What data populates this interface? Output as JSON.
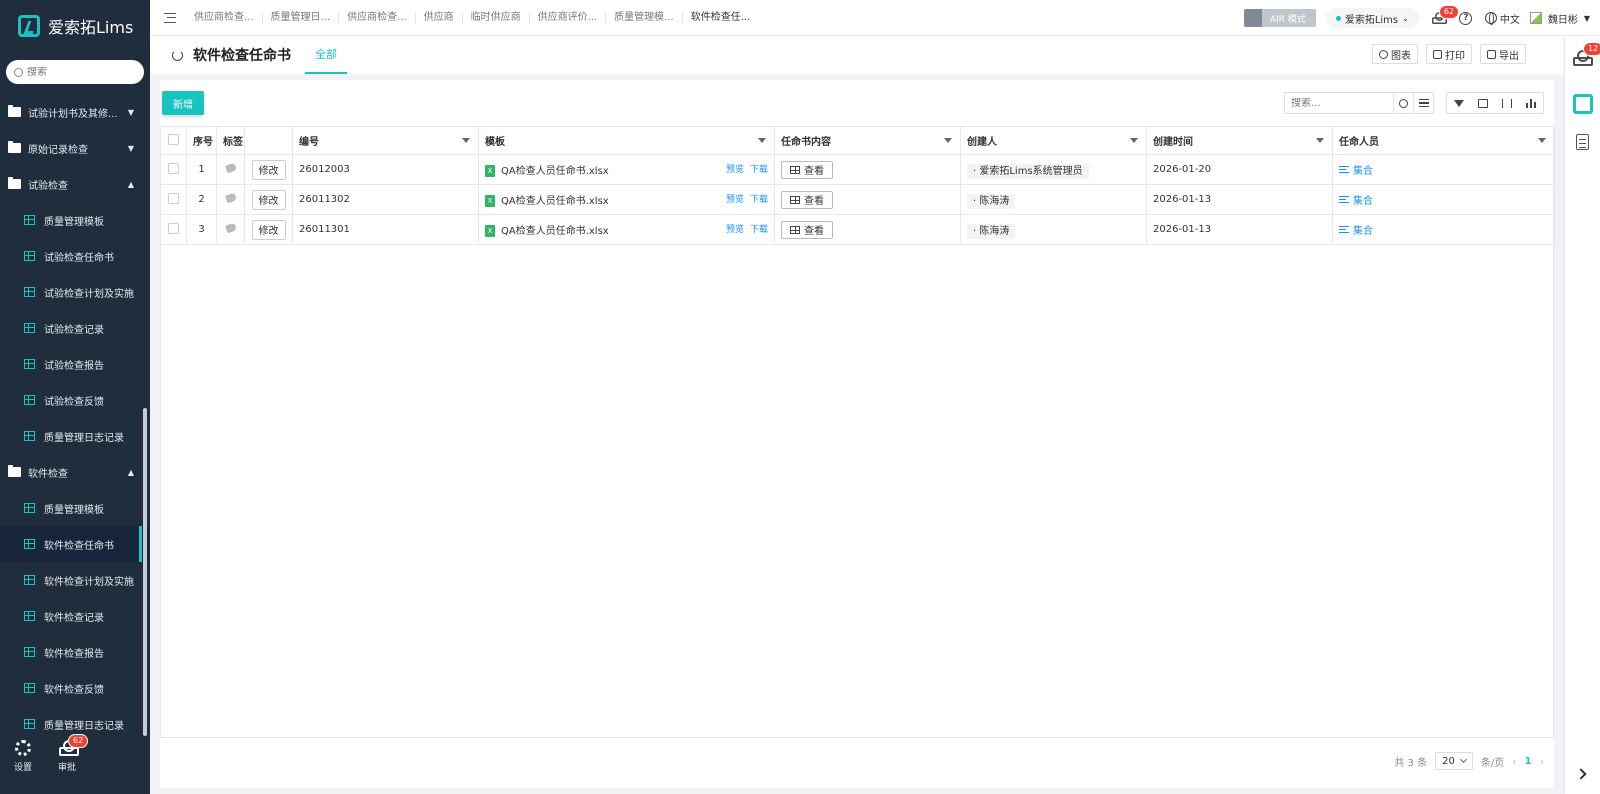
{
  "app": {
    "name": "爱索拓Lims"
  },
  "sidebar": {
    "search_placeholder": "搜索",
    "groups": [
      {
        "label": "试验计划书及其修...",
        "expanded": false
      },
      {
        "label": "原始记录检查",
        "expanded": false
      },
      {
        "label": "试验检查",
        "expanded": true,
        "items": [
          "质量管理模板",
          "试验检查任命书",
          "试验检查计划及实施",
          "试验检查记录",
          "试验检查报告",
          "试验检查反馈",
          "质量管理日志记录"
        ]
      },
      {
        "label": "软件检查",
        "expanded": true,
        "items": [
          "质量管理模板",
          "软件检查任命书",
          "软件检查计划及实施",
          "软件检查记录",
          "软件检查报告",
          "软件检查反馈",
          "质量管理日志记录"
        ]
      }
    ],
    "active_item": "软件检查任命书",
    "bottom": {
      "settings_label": "设置",
      "approval_label": "审批",
      "approval_badge": "62"
    }
  },
  "topbar": {
    "tabs": [
      "供应商检查...",
      "质量管理日...",
      "供应商检查...",
      "供应商",
      "临时供应商",
      "供应商评价...",
      "质量管理模...",
      "软件检查任..."
    ],
    "air_mode_label": "AIR 模式",
    "env_label": "爱索拓Lims",
    "notif_badge": "62",
    "lang_label": "中文",
    "user_name": "魏日彬"
  },
  "right_dock": {
    "badge": "12"
  },
  "page": {
    "title": "软件检查任命书",
    "view_tab": "全部",
    "actions": {
      "chart": "图表",
      "print": "打印",
      "export": "导出"
    },
    "add_button": "新增",
    "search_placeholder": "搜索..."
  },
  "table": {
    "columns": [
      "序号",
      "标签",
      "",
      "编号",
      "模板",
      "任命书内容",
      "创建人",
      "创建时间",
      "任命人员"
    ],
    "edit_label": "修改",
    "preview_label": "预览",
    "download_label": "下载",
    "view_label": "查看",
    "collection_label": "集合",
    "rows": [
      {
        "index": "1",
        "code": "26012003",
        "template": "QA检查人员任命书.xlsx",
        "creator": "爱索拓Lims系统管理员",
        "created": "2026-01-20"
      },
      {
        "index": "2",
        "code": "26011302",
        "template": "QA检查人员任命书.xlsx",
        "creator": "陈海涛",
        "created": "2026-01-13"
      },
      {
        "index": "3",
        "code": "26011301",
        "template": "QA检查人员任命书.xlsx",
        "creator": "陈海涛",
        "created": "2026-01-13"
      }
    ]
  },
  "pager": {
    "total": "共 3 条",
    "page_size": "20",
    "per_page": "条/页",
    "current": "1"
  },
  "colors": {
    "accent": "#19c3c0",
    "sidebar_bg": "#1f2d3d",
    "link": "#1890ff",
    "badge": "#f04134"
  }
}
